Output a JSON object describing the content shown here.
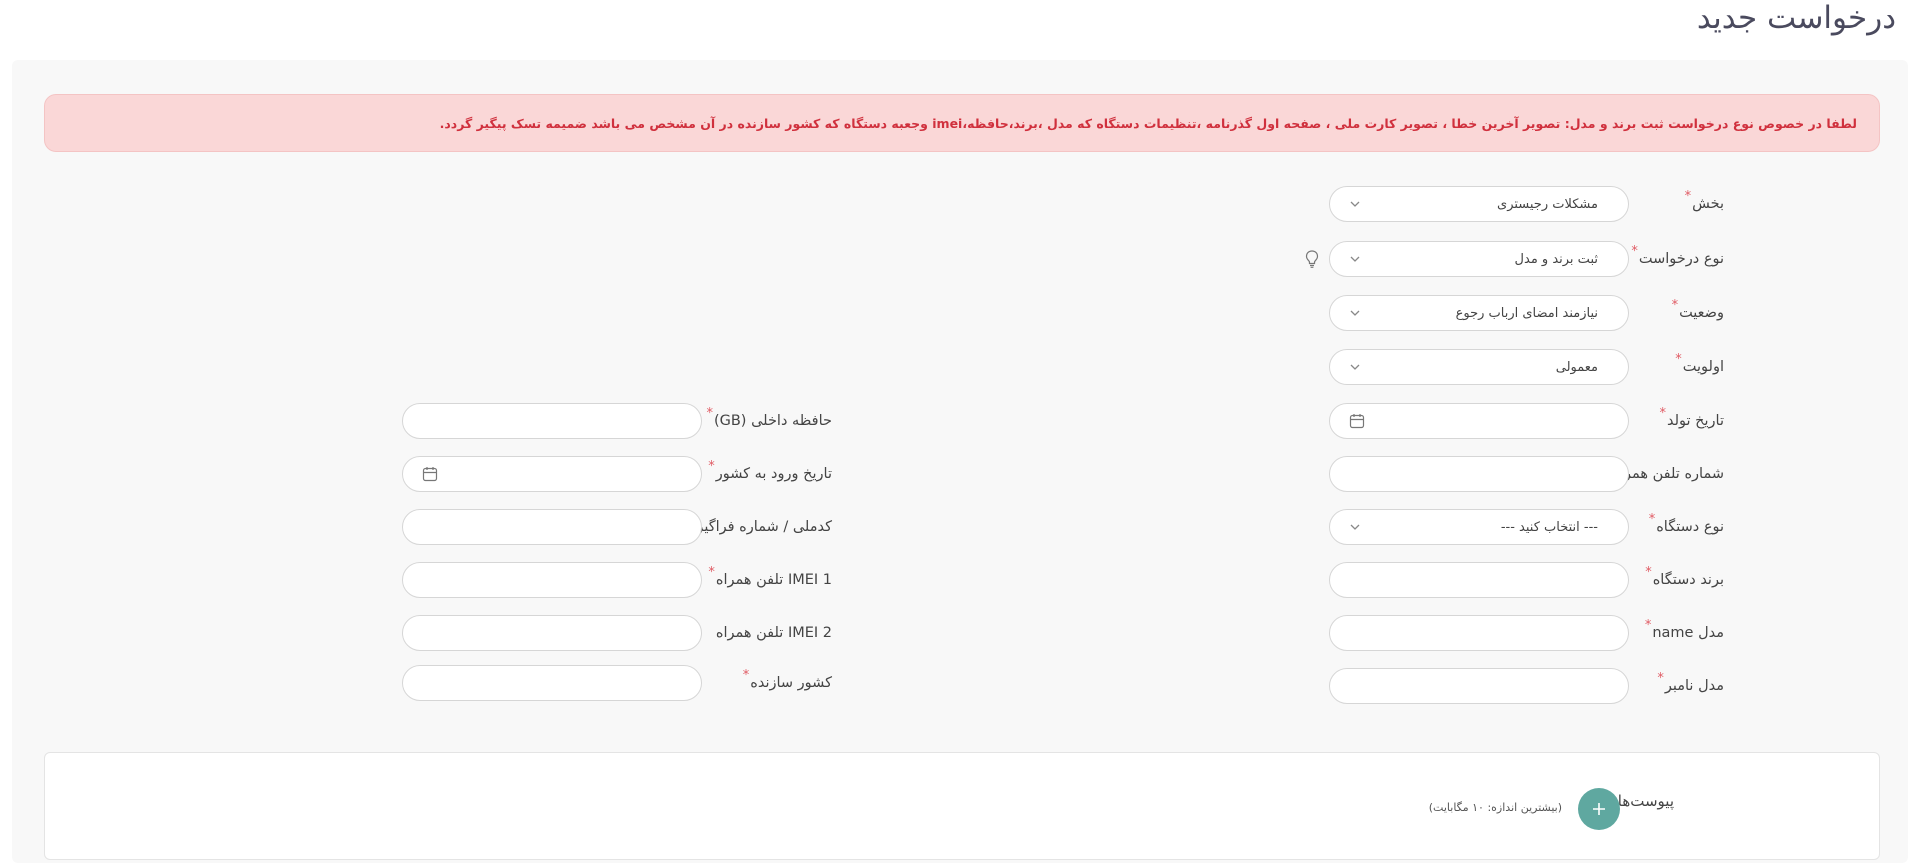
{
  "page": {
    "title": "درخواست جدید"
  },
  "alert": {
    "message": "لطفا در خصوص نوع درخواست ثبت برند و مدل: تصویر آخرین خطا ، تصویر کارت ملی ، صفحه اول گذرنامه ،تنظیمات دستگاه که مدل ،برند،حافظه،imei وجعبه دستگاه که کشور سازنده در آن مشخص می باشد ضمیمه تسک پیگیر گردد."
  },
  "form": {
    "required_mark": "*",
    "section": {
      "label": "بخش",
      "value": "مشکلات رجیستری"
    },
    "request_type": {
      "label": "نوع درخواست",
      "value": "ثبت برند و مدل"
    },
    "status": {
      "label": "وضعیت",
      "value": "نیازمند امضای ارباب رجوع"
    },
    "priority": {
      "label": "اولویت",
      "value": "معمولی"
    },
    "birth_date": {
      "label": "تاریخ تولد",
      "value": ""
    },
    "mobile_number": {
      "label": "شماره تلفن همراه",
      "value": ""
    },
    "device_type": {
      "label": "نوع دستگاه",
      "value": "--- انتخاب کنید ---"
    },
    "device_brand": {
      "label": "برند دستگاه",
      "value": ""
    },
    "model_name": {
      "label": "مدل name",
      "value": ""
    },
    "model_number": {
      "label": "مدل نامبر",
      "value": ""
    },
    "internal_memory": {
      "label": "حافظه داخلی (GB)",
      "value": ""
    },
    "entry_date": {
      "label": "تاریخ ورود به کشور",
      "value": ""
    },
    "national_id": {
      "label": "کدملی / شماره فراگیر",
      "value": ""
    },
    "imei1": {
      "label": "IMEI 1 تلفن همراه",
      "value": ""
    },
    "imei2": {
      "label": "IMEI 2 تلفن همراه",
      "value": ""
    },
    "manufacturer_country": {
      "label": "کشور سازنده",
      "value": ""
    }
  },
  "attachments": {
    "label": "پیوست‌ها",
    "max_size_note": "(بیشترین اندازه: ۱۰ مگابایت)",
    "add_icon": "plus-icon"
  },
  "colors": {
    "alert_bg": "#fad7d7",
    "alert_text": "#d0303d",
    "required": "#e05a63",
    "accent": "#5fa8a0"
  }
}
